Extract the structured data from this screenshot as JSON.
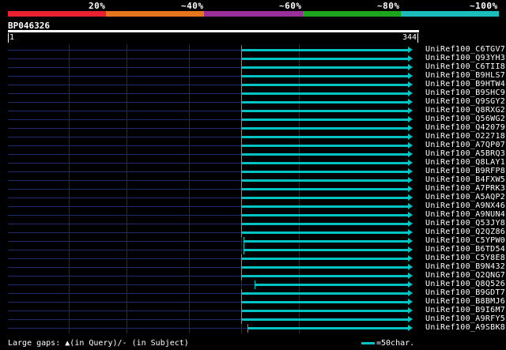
{
  "percent_scale": {
    "labels": [
      "20%",
      "~40%",
      "~60%",
      "~80%",
      "~100%"
    ],
    "colors": [
      "#e8202f",
      "#e5761d",
      "#9a2f9a",
      "#1da61d",
      "#1cbcbc"
    ]
  },
  "query": {
    "id": "BP046326",
    "start": "1",
    "end": "344"
  },
  "hits": [
    {
      "label": "UniRef100_C6TGV7",
      "start_fraction": 0.578
    },
    {
      "label": "UniRef100_Q93YH3",
      "start_fraction": 0.578
    },
    {
      "label": "UniRef100_C6TII8",
      "start_fraction": 0.578
    },
    {
      "label": "UniRef100_B9HLS7",
      "start_fraction": 0.578
    },
    {
      "label": "UniRef100_B9HTW4",
      "start_fraction": 0.578
    },
    {
      "label": "UniRef100_B9SHC9",
      "start_fraction": 0.578
    },
    {
      "label": "UniRef100_Q9SGY2",
      "start_fraction": 0.578
    },
    {
      "label": "UniRef100_Q8RXG2",
      "start_fraction": 0.578
    },
    {
      "label": "UniRef100_Q56WG2",
      "start_fraction": 0.578
    },
    {
      "label": "UniRef100_Q42079",
      "start_fraction": 0.578
    },
    {
      "label": "UniRef100_O22718",
      "start_fraction": 0.578
    },
    {
      "label": "UniRef100_A7QP07",
      "start_fraction": 0.578
    },
    {
      "label": "UniRef100_A5BRQ3",
      "start_fraction": 0.578
    },
    {
      "label": "UniRef100_Q8LAY1",
      "start_fraction": 0.578
    },
    {
      "label": "UniRef100_B9RFP8",
      "start_fraction": 0.578
    },
    {
      "label": "UniRef100_B4FXW5",
      "start_fraction": 0.578
    },
    {
      "label": "UniRef100_A7PRK3",
      "start_fraction": 0.578
    },
    {
      "label": "UniRef100_A5AQP2",
      "start_fraction": 0.578
    },
    {
      "label": "UniRef100_A9NX46",
      "start_fraction": 0.578
    },
    {
      "label": "UniRef100_A9NUN4",
      "start_fraction": 0.578
    },
    {
      "label": "UniRef100_Q53JY8",
      "start_fraction": 0.578
    },
    {
      "label": "UniRef100_Q2QZ86",
      "start_fraction": 0.578
    },
    {
      "label": "UniRef100_C5YPW0",
      "start_fraction": 0.584
    },
    {
      "label": "UniRef100_B6TD54",
      "start_fraction": 0.584
    },
    {
      "label": "UniRef100_C5Y8E8",
      "start_fraction": 0.578
    },
    {
      "label": "UniRef100_B9N432",
      "start_fraction": 0.578
    },
    {
      "label": "UniRef100_Q2QNG7",
      "start_fraction": 0.578
    },
    {
      "label": "UniRef100_Q8Q526",
      "start_fraction": 0.611
    },
    {
      "label": "UniRef100_B9GDT7",
      "start_fraction": 0.578
    },
    {
      "label": "UniRef100_B8BMJ6",
      "start_fraction": 0.578
    },
    {
      "label": "UniRef100_B9I6M7",
      "start_fraction": 0.578
    },
    {
      "label": "UniRef100_A9RFY5",
      "start_fraction": 0.578
    },
    {
      "label": "UniRef100_A9SBK8",
      "start_fraction": 0.592
    }
  ],
  "legend": {
    "prefix": "Large gaps:",
    "query_text": "(in Query)/",
    "subject_symbol": "-",
    "subject_text": " (in Subject)",
    "scale_text": "=50char."
  }
}
